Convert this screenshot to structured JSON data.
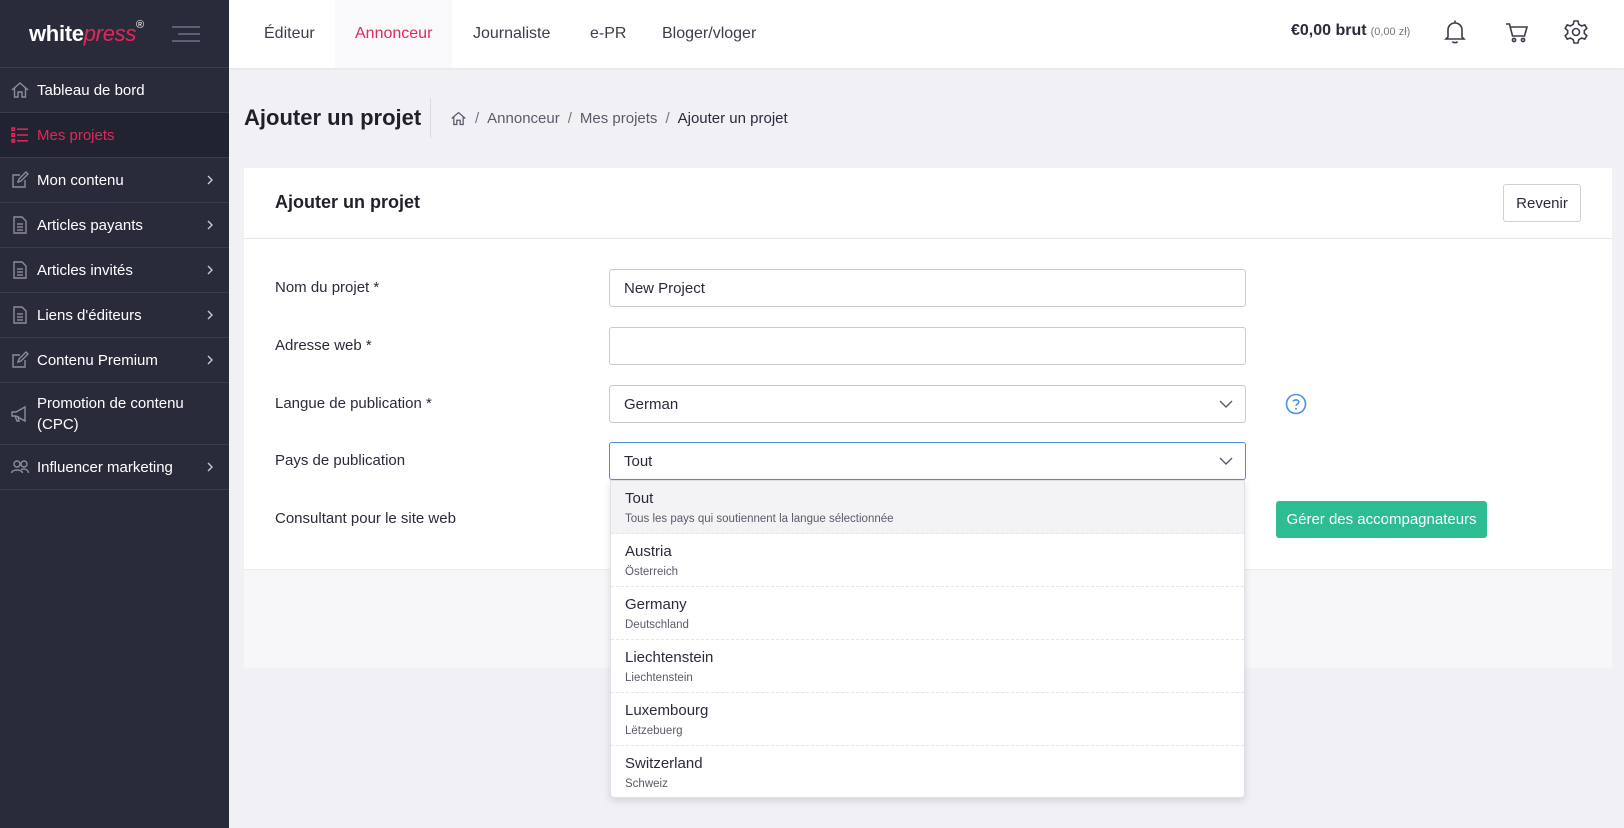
{
  "brand": {
    "name_white": "white",
    "name_press": "press",
    "mark": "®"
  },
  "sidebar": {
    "items": [
      {
        "label": "Tableau de bord",
        "icon": "home-icon",
        "chevron": false
      },
      {
        "label": "Mes projets",
        "icon": "list-icon",
        "chevron": false,
        "active": true
      },
      {
        "label": "Mon contenu",
        "icon": "edit-icon",
        "chevron": true
      },
      {
        "label": "Articles payants",
        "icon": "document-icon",
        "chevron": true
      },
      {
        "label": "Articles invités",
        "icon": "document-icon",
        "chevron": true
      },
      {
        "label": "Liens d'éditeurs",
        "icon": "document-icon",
        "chevron": true
      },
      {
        "label": "Contenu Premium",
        "icon": "edit-icon",
        "chevron": true
      },
      {
        "label": "Promotion de contenu (CPC)",
        "icon": "megaphone-icon",
        "chevron": false
      },
      {
        "label": "Influencer marketing",
        "icon": "users-icon",
        "chevron": true
      }
    ]
  },
  "topbar": {
    "tabs": [
      "Éditeur",
      "Annonceur",
      "Journaliste",
      "e-PR",
      "Bloger/vloger"
    ],
    "active_tab": "Annonceur",
    "balance": "€0,00 brut",
    "balance_pln": "(0,00 zł)"
  },
  "page": {
    "title": "Ajouter un projet",
    "breadcrumb": [
      "Annonceur",
      "Mes projets",
      "Ajouter un projet"
    ]
  },
  "card": {
    "title": "Ajouter un projet",
    "back_label": "Revenir"
  },
  "form": {
    "project_name_label": "Nom du projet *",
    "project_name_value": "New Project",
    "web_address_label": "Adresse web *",
    "web_address_value": "",
    "language_label": "Langue de publication *",
    "language_value": "German",
    "country_label": "Pays de publication",
    "country_value": "Tout",
    "consultant_label": "Consultant pour le site web",
    "manage_button": "Gérer des accompagnateurs"
  },
  "dropdown": {
    "options": [
      {
        "name": "Tout",
        "sub": "Tous les pays qui soutiennent la langue sélectionnée",
        "selected": true
      },
      {
        "name": "Austria",
        "sub": "Österreich"
      },
      {
        "name": "Germany",
        "sub": "Deutschland"
      },
      {
        "name": "Liechtenstein",
        "sub": "Liechtenstein"
      },
      {
        "name": "Luxembourg",
        "sub": "Lëtzebuerg"
      },
      {
        "name": "Switzerland",
        "sub": "Schweiz"
      }
    ]
  },
  "colors": {
    "accent": "#e2285a",
    "sidebar_bg": "#2a2b3a",
    "success": "#2ebd92",
    "help": "#4a90e2"
  }
}
